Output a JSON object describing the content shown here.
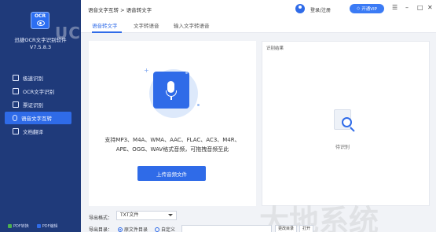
{
  "app": {
    "name": "迅捷OCR文字识别软件",
    "version": "V7.5.8.3",
    "watermark": "UC"
  },
  "sidebar": {
    "items": [
      {
        "label": "极速识别",
        "icon": "edit-icon"
      },
      {
        "label": "OCR文字识别",
        "icon": "scan-icon"
      },
      {
        "label": "票证识别",
        "icon": "card-icon"
      },
      {
        "label": "语音文字互转",
        "icon": "mic-icon",
        "active": true
      },
      {
        "label": "文档翻译",
        "icon": "translate-icon"
      }
    ],
    "bottom": [
      {
        "label": "PDF转换"
      },
      {
        "label": "PDF编辑"
      }
    ]
  },
  "header": {
    "breadcrumb": "语音文字互转 > 语音转文字",
    "login": "登录/注册",
    "vip": "开通VIP",
    "window_controls": [
      "☰",
      "–",
      "□",
      "✕"
    ]
  },
  "tabs": [
    {
      "label": "语音转文字",
      "active": true
    },
    {
      "label": "文字转语音"
    },
    {
      "label": "输入文字转语音"
    }
  ],
  "upload": {
    "formats_line1": "支持MP3、M4A、WMA、AAC、FLAC、AC3、M4R、",
    "formats_line2": "APE、OGG、WAV格式音频，可拖拽音频至此",
    "button": "上传音频文件"
  },
  "result": {
    "title": "识别结果",
    "pending": "待识别"
  },
  "settings": {
    "export_format_label": "导出格式：",
    "export_format_value": "TXT文件",
    "export_dir_label": "导出目录：",
    "radio_original": "原文件目录",
    "radio_custom": "自定义",
    "change_dir": "更改目录",
    "open": "打开"
  },
  "watermark_bottom": "大地系统",
  "colors": {
    "sidebar": "#1f3a7a",
    "accent": "#2f6be8",
    "panel_bg": "#f1f3f7"
  }
}
